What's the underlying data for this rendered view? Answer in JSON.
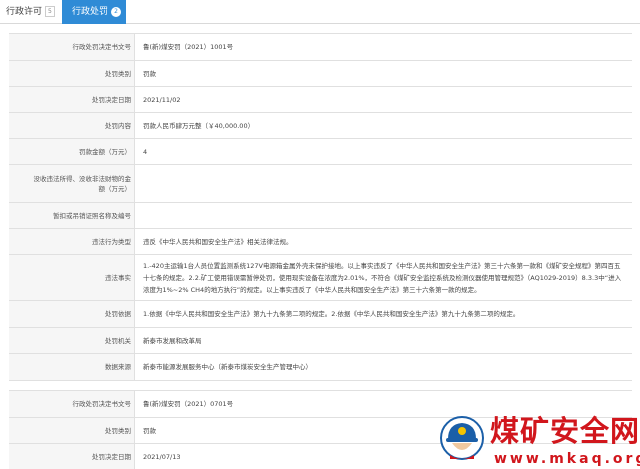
{
  "tabs": [
    {
      "label": "行政许可",
      "count": "5"
    },
    {
      "label": "行政处罚",
      "count": "2"
    }
  ],
  "record1": [
    {
      "label": "行政处罚决定书文号",
      "value": "鲁(新)煤安罚（2021）1001号"
    },
    {
      "label": "处罚类别",
      "value": "罚款"
    },
    {
      "label": "处罚决定日期",
      "value": "2021/11/02"
    },
    {
      "label": "处罚内容",
      "value": "罚款人民币肆万元整（￥40,000.00）"
    },
    {
      "label": "罚款金额（万元）",
      "value": "4"
    },
    {
      "label": "没收违法所得、没收非法财物的金额（万元）",
      "value": ""
    },
    {
      "label": "暂扣或吊销证照名称及编号",
      "value": ""
    },
    {
      "label": "违法行为类型",
      "value": "违反《中华人民共和国安全生产法》相关法律法规。"
    },
    {
      "label": "违法事实",
      "value": "1.-420主运输1台人员位置监测系统127V电源箱金属外壳未保护接地。以上事实违反了《中华人民共和国安全生产法》第三十六条第一款和《煤矿安全规程》第四百五十七条的规定。2.2.矿工使用错误需暂停处罚，使用现实设备在浓度为2.01%，不符合《煤矿安全监控系统及检测仪器使用管理规范》（AQ1029-2019）8.3.3中“进入浓度为1%~2% CH4的地方执行”的规定。以上事实违反了《中华人民共和国安全生产法》第三十六条第一款的规定。"
    },
    {
      "label": "处罚依据",
      "value": "1.依据《中华人民共和国安全生产法》第九十九条第二项的规定。2.依据《中华人民共和国安全生产法》第九十九条第二项的规定。"
    },
    {
      "label": "处罚机关",
      "value": "新泰市发展和改革局"
    },
    {
      "label": "数据来源",
      "value": "新泰市能源发展服务中心（新泰市煤炭安全生产管理中心）"
    }
  ],
  "record2": [
    {
      "label": "行政处罚决定书文号",
      "value": "鲁(新)煤安罚（2021）0701号"
    },
    {
      "label": "处罚类别",
      "value": "罚款"
    },
    {
      "label": "处罚决定日期",
      "value": "2021/07/13"
    }
  ],
  "watermark": {
    "title": "煤矿安全网",
    "url": "www.mkaq.org",
    "color": "#d1161c",
    "logo_icon": "miner-helmet-icon"
  }
}
